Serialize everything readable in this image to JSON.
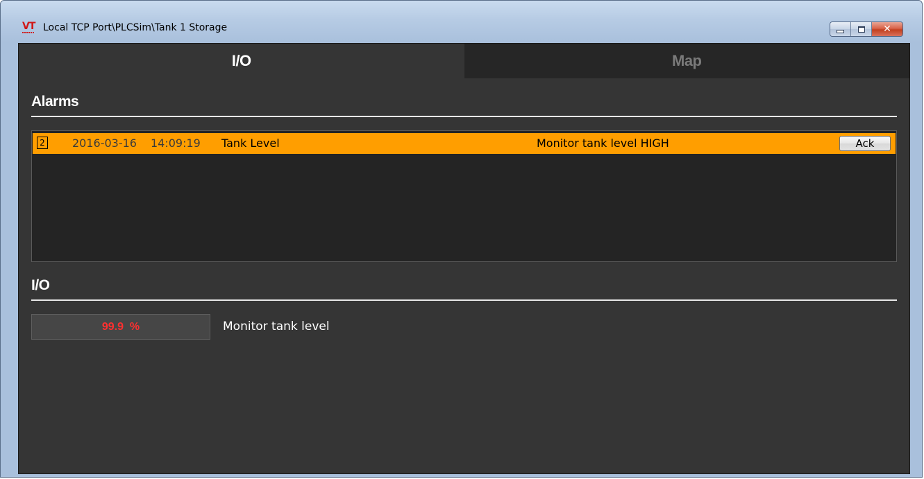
{
  "window": {
    "app_icon_text": "VT",
    "title": "Local TCP Port\\PLCSim\\Tank 1 Storage",
    "buttons": {
      "minimize": "minimize",
      "maximize": "maximize",
      "close": "✕"
    }
  },
  "tabs": [
    {
      "label": "I/O",
      "active": true
    },
    {
      "label": "Map",
      "active": false
    }
  ],
  "alarms_section": {
    "heading": "Alarms",
    "rows": [
      {
        "priority": "2",
        "date": "2016-03-16",
        "time": "14:09:19",
        "source": "Tank Level",
        "message": "Monitor tank level HIGH",
        "ack_label": "Ack",
        "row_color": "#ff9e00"
      }
    ]
  },
  "io_section": {
    "heading": "I/O",
    "items": [
      {
        "value": "99.9  %",
        "value_color": "#ff3030",
        "label": "Monitor tank level"
      }
    ]
  }
}
